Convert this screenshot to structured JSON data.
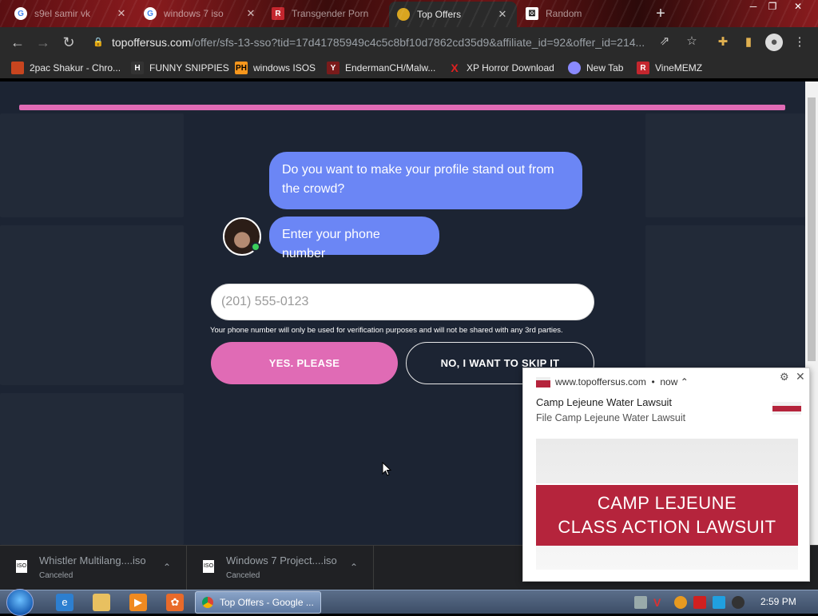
{
  "browser": {
    "tabs": [
      {
        "label": "s9el samir vk",
        "icon": "google-icon",
        "active": false
      },
      {
        "label": "windows 7 iso",
        "icon": "google-icon",
        "active": false
      },
      {
        "label": "Transgender Porn",
        "icon": "r-logo-icon",
        "active": false
      },
      {
        "label": "Top Offers",
        "icon": "offer-icon",
        "active": true
      },
      {
        "label": "Random",
        "icon": "dice-icon",
        "active": false
      }
    ],
    "url_host": "topoffersus.com",
    "url_path": "/offer/sfs-13-sso?tid=17d41785949c4c5c8bf10d7862cd35d9&affiliate_id=92&offer_id=214..."
  },
  "bookmarks": [
    {
      "label": "2pac Shakur - Chro...",
      "icon": "bookmark-folder-icon",
      "color": "#c8451f"
    },
    {
      "label": "FUNNY SNIPPIES",
      "icon": "h-logo-icon",
      "color": "#333333"
    },
    {
      "label": "windows ISOS",
      "icon": "ph-logo-icon",
      "color": "#f7971d"
    },
    {
      "label": "EndermanCH/Malw...",
      "icon": "yp-logo-icon",
      "color": "#7a1b1b"
    },
    {
      "label": "XP Horror Download",
      "icon": "x-logo-icon",
      "color": "#e02020"
    },
    {
      "label": "New Tab",
      "icon": "globe-icon",
      "color": "#8a8aff"
    },
    {
      "label": "VineMEMZ",
      "icon": "r-logo-icon",
      "color": "#c4262e"
    }
  ],
  "offer": {
    "question": "Do you want to make your profile stand out from the crowd?",
    "prompt": "Enter your phone number",
    "phone_placeholder": "(201) 555-0123",
    "disclaimer": "Your phone number will only be used for verification purposes and will not be shared with any 3rd parties.",
    "yes_label": "YES. PLEASE",
    "no_label": "NO, I WANT TO SKIP IT",
    "accent_color": "#e06bb5",
    "bubble_color": "#6b86f5"
  },
  "downloads": [
    {
      "name": "Whistler Multilang....iso",
      "status": "Canceled"
    },
    {
      "name": "Windows 7 Project....iso",
      "status": "Canceled"
    }
  ],
  "notification": {
    "source": "www.topoffersus.com",
    "time": "now",
    "title": "Camp Lejeune Water Lawsuit",
    "body": "File Camp Lejeune Water Lawsuit",
    "banner_line1": "CAMP LEJEUNE",
    "banner_line2": "CLASS ACTION LAWSUIT"
  },
  "taskbar": {
    "active_window": "Top Offers - Google ...",
    "clock": "2:59 PM"
  }
}
